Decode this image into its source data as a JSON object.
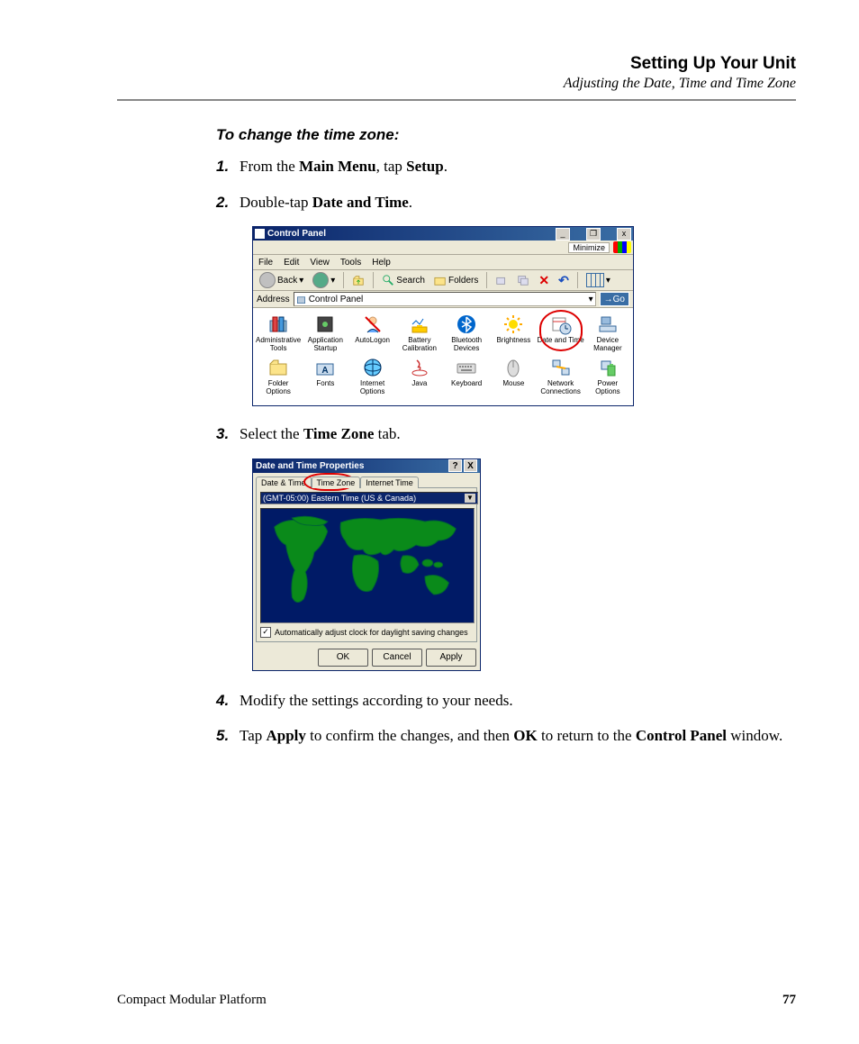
{
  "header": {
    "title": "Setting Up Your Unit",
    "subtitle": "Adjusting the Date, Time and Time Zone"
  },
  "section_title": "To change the time zone:",
  "steps": {
    "s1": {
      "num": "1.",
      "pre": "From the ",
      "b1": "Main Menu",
      "mid": ", tap ",
      "b2": "Setup",
      "post": "."
    },
    "s2": {
      "num": "2.",
      "pre": "Double-tap ",
      "b1": "Date and Time",
      "post": "."
    },
    "s3": {
      "num": "3.",
      "pre": "Select the ",
      "b1": "Time Zone",
      "post": " tab."
    },
    "s4": {
      "num": "4.",
      "text": "Modify the settings according to your needs."
    },
    "s5": {
      "num": "5.",
      "pre": "Tap ",
      "b1": "Apply",
      "mid1": " to confirm the changes, and then ",
      "b2": "OK",
      "mid2": " to return to the ",
      "b3": "Control Panel",
      "post": " window."
    }
  },
  "cp": {
    "title": "Control Panel",
    "minimize_label": "Minimize",
    "btn_min": "_",
    "btn_max": "❐",
    "btn_close": "x",
    "menu": {
      "file": "File",
      "edit": "Edit",
      "view": "View",
      "tools": "Tools",
      "help": "Help"
    },
    "toolbar": {
      "back": "Back",
      "search": "Search",
      "folders": "Folders"
    },
    "address_label": "Address",
    "address_value": "Control Panel",
    "go": "Go",
    "items": [
      "Administrative Tools",
      "Application Startup",
      "AutoLogon",
      "Battery Calibration",
      "Bluetooth Devices",
      "Brightness",
      "Date and Time",
      "Device Manager",
      "Folder Options",
      "Fonts",
      "Internet Options",
      "Java",
      "Keyboard",
      "Mouse",
      "Network Connections",
      "Power Options"
    ]
  },
  "dt": {
    "title": "Date and Time Properties",
    "btn_help": "?",
    "btn_close": "X",
    "tabs": {
      "t1": "Date & Time",
      "t2": "Time Zone",
      "t3": "Internet Time"
    },
    "timezone": "(GMT-05:00) Eastern Time (US & Canada)",
    "dst_label": "Automatically adjust clock for daylight saving changes",
    "ok": "OK",
    "cancel": "Cancel",
    "apply": "Apply"
  },
  "footer": {
    "product": "Compact Modular Platform",
    "page": "77"
  }
}
